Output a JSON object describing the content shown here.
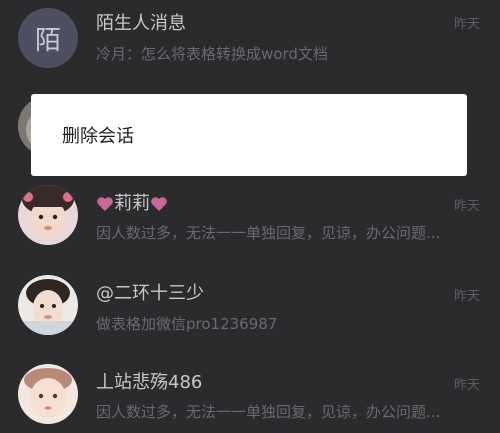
{
  "conversations": [
    {
      "name": "陌生人消息",
      "avatar_text": "陌",
      "time": "昨天",
      "preview": "冷月：怎么将表格转换成word文档"
    },
    {
      "name": "",
      "time": "",
      "preview": ""
    },
    {
      "name": "莉莉",
      "time": "昨天",
      "preview": "因人数过多，无法一一单独回复，见谅，办公问题..."
    },
    {
      "name": "@二环十三少",
      "time": "昨天",
      "preview": "做表格加微信pro1236987"
    },
    {
      "name": "丄站悲殇486",
      "time": "昨天",
      "preview": "因人数过多，无法一一单独回复，见谅，办公问题..."
    }
  ],
  "context_menu": {
    "delete_label": "删除会话"
  },
  "colors": {
    "background": "#2b2b2d",
    "heart": "#c7679a",
    "dialog": "#ffffff"
  },
  "icons": {
    "heart": "heart-icon"
  }
}
